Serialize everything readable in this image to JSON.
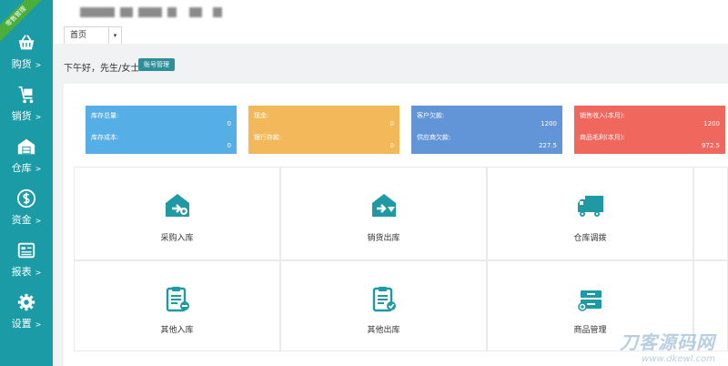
{
  "sidebar": {
    "ribbon": "零售管理",
    "items": [
      {
        "label": "购货",
        "icon": "basket-icon"
      },
      {
        "label": "销货",
        "icon": "cart-icon"
      },
      {
        "label": "仓库",
        "icon": "warehouse-icon"
      },
      {
        "label": "资金",
        "icon": "coin-icon"
      },
      {
        "label": "报表",
        "icon": "report-icon"
      },
      {
        "label": "设置",
        "icon": "gear-icon"
      }
    ],
    "arrow": ">"
  },
  "tabs": {
    "home": "首页",
    "dropdown": "▾"
  },
  "greeting": "下午好，先生/女士",
  "account_button": "账号管理",
  "stats": [
    {
      "label1": "库存总量:",
      "value1": "0",
      "label2": "库存成本:",
      "value2": "0",
      "color": "#56aee6"
    },
    {
      "label1": "现金:",
      "value1": "0",
      "label2": "银行存款:",
      "value2": "0",
      "color": "#f3b859"
    },
    {
      "label1": "客户欠款:",
      "value1": "1200",
      "label2": "供应商欠款:",
      "value2": "227.5",
      "color": "#6295d8"
    },
    {
      "label1": "销售收入(本月):",
      "value1": "1200",
      "label2": "商品毛利(本月):",
      "value2": "972.5",
      "color": "#f0675d"
    }
  ],
  "tiles": [
    {
      "label": "采购入库",
      "icon": "purchase-in-icon"
    },
    {
      "label": "销货出库",
      "icon": "sales-out-icon"
    },
    {
      "label": "仓库调拨",
      "icon": "truck-icon"
    },
    {
      "label": "其他入库",
      "icon": "clipboard-in-icon"
    },
    {
      "label": "其他出库",
      "icon": "clipboard-out-icon"
    },
    {
      "label": "商品管理",
      "icon": "product-icon"
    }
  ],
  "watermark": {
    "line1": "刀客源码网",
    "line2": "www.dkewl.com"
  },
  "colors": {
    "sidebar": "#1b9ba6",
    "accent": "#1f9aa5"
  }
}
